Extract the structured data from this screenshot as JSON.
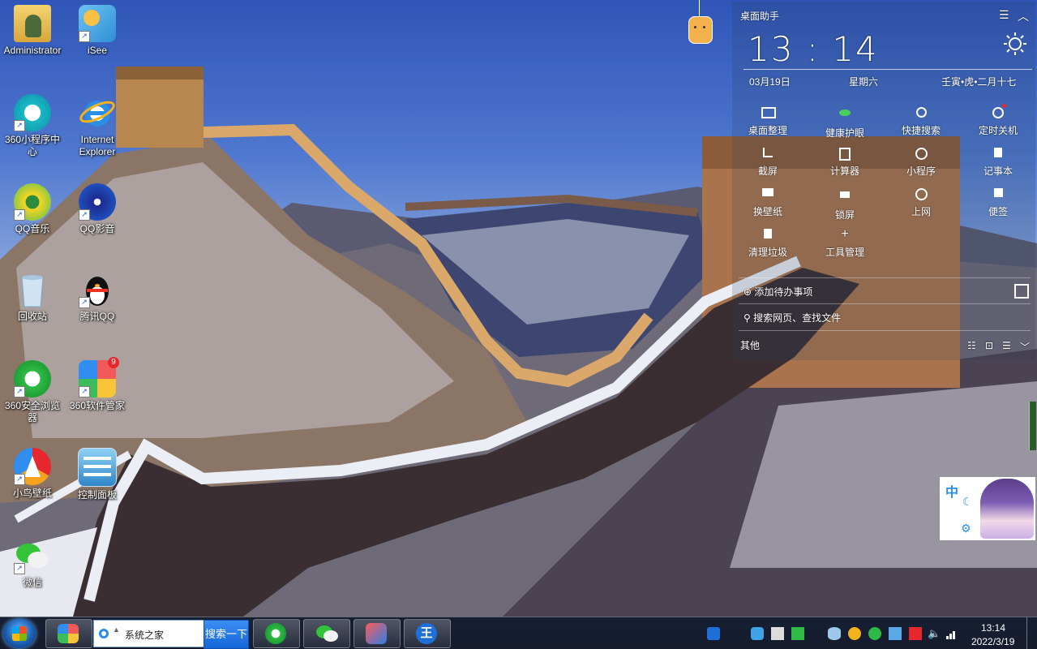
{
  "desktop_icons": [
    {
      "label": "Administrator",
      "icon": "user-folder-icon"
    },
    {
      "label": "iSee",
      "icon": "isee-photo-icon"
    },
    {
      "label": "360小程序中心",
      "icon": "360-miniapp-icon"
    },
    {
      "label": "Internet Explorer",
      "icon": "ie-icon"
    },
    {
      "label": "QQ音乐",
      "icon": "qq-music-icon"
    },
    {
      "label": "QQ影音",
      "icon": "qq-player-icon"
    },
    {
      "label": "回收站",
      "icon": "recycle-bin-icon"
    },
    {
      "label": "腾讯QQ",
      "icon": "qq-penguin-icon"
    },
    {
      "label": "360安全浏览器",
      "icon": "360-browser-icon"
    },
    {
      "label": "360软件管家",
      "icon": "360-software-manager-icon"
    },
    {
      "label": "小鸟壁纸",
      "icon": "bird-wallpaper-icon"
    },
    {
      "label": "控制面板",
      "icon": "control-panel-icon"
    },
    {
      "label": "微信",
      "icon": "wechat-icon"
    }
  ],
  "software_manager_badge": "9",
  "widget": {
    "title": "桌面助手",
    "time_hour": "13",
    "time_minute": "14",
    "time_sep": ":",
    "date": "03月19日",
    "weekday": "星期六",
    "lunar": "壬寅•虎•二月十七",
    "tools": [
      {
        "label": "桌面整理",
        "icon": "monitor-icon"
      },
      {
        "label": "健康护眼",
        "icon": "eye-icon"
      },
      {
        "label": "快捷搜索",
        "icon": "search-icon"
      },
      {
        "label": "定时关机",
        "icon": "power-icon"
      },
      {
        "label": "截屏",
        "icon": "crop-icon"
      },
      {
        "label": "计算器",
        "icon": "calculator-icon"
      },
      {
        "label": "小程序",
        "icon": "miniapp-icon"
      },
      {
        "label": "记事本",
        "icon": "notepad-icon"
      },
      {
        "label": "换壁纸",
        "icon": "image-icon"
      },
      {
        "label": "锁屏",
        "icon": "lock-icon"
      },
      {
        "label": "上网",
        "icon": "globe-icon"
      },
      {
        "label": "便签",
        "icon": "sticky-note-icon"
      },
      {
        "label": "清理垃圾",
        "icon": "trash-icon"
      },
      {
        "label": "工具管理",
        "icon": "plus-icon"
      }
    ],
    "add_todo": "添加待办事项",
    "search_placeholder": "搜索网页、查找文件",
    "other_label": "其他"
  },
  "taskbar": {
    "search_text": "系统之家",
    "search_button": "搜索一下",
    "apps": [
      {
        "name": "360-software-manager-icon"
      },
      {
        "name": "360-browser-icon"
      },
      {
        "name": "wechat-icon"
      },
      {
        "name": "game-icon"
      },
      {
        "name": "wang-icon"
      }
    ],
    "clock_time": "13:14",
    "clock_date": "2022/3/19"
  },
  "colors": {
    "taskbar_blue": "#1565d8",
    "badge_red": "#e8262d",
    "wechat_green": "#33c439"
  }
}
